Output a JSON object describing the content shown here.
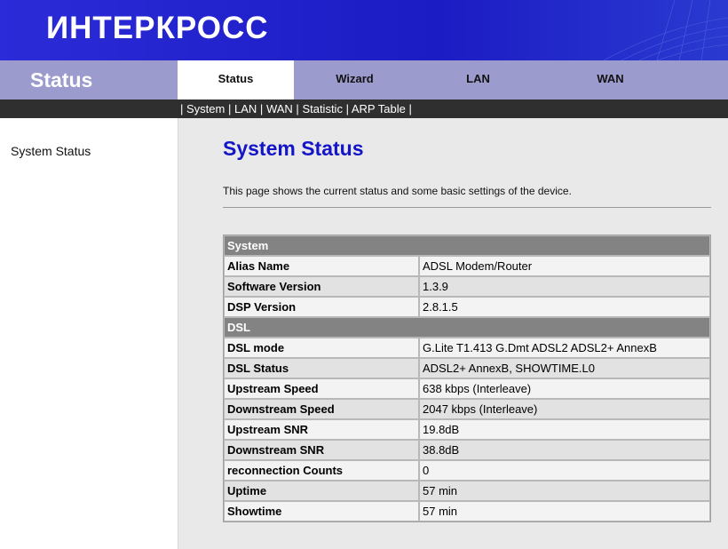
{
  "brand": {
    "logo_text": "ИНТЕРКРОСС"
  },
  "nav": {
    "title": "Status",
    "tabs": [
      {
        "label": "Status",
        "active": true
      },
      {
        "label": "Wizard",
        "active": false
      },
      {
        "label": "LAN",
        "active": false
      },
      {
        "label": "WAN",
        "active": false
      }
    ]
  },
  "subnav": {
    "separator": "|",
    "links": [
      "System",
      "LAN",
      "WAN",
      "Statistic",
      "ARP Table"
    ]
  },
  "sidebar": {
    "items": [
      "System Status"
    ]
  },
  "main": {
    "title": "System Status",
    "description": "This page shows the current status and some basic settings of the device."
  },
  "table": {
    "system_header": "System",
    "system_rows": [
      {
        "label": "Alias Name",
        "value": "ADSL Modem/Router"
      },
      {
        "label": "Software Version",
        "value": "1.3.9"
      },
      {
        "label": "DSP Version",
        "value": "2.8.1.5"
      }
    ],
    "dsl_header": "DSL",
    "dsl_rows": [
      {
        "label": "DSL mode",
        "value": "G.Lite T1.413 G.Dmt ADSL2 ADSL2+ AnnexB"
      },
      {
        "label": "DSL Status",
        "value": "ADSL2+ AnnexB, SHOWTIME.L0"
      },
      {
        "label": "Upstream Speed",
        "value": "638 kbps  (Interleave)"
      },
      {
        "label": "Downstream Speed",
        "value": "2047 kbps  (Interleave)"
      },
      {
        "label": "Upstream SNR",
        "value": "19.8dB"
      },
      {
        "label": "Downstream SNR",
        "value": "38.8dB"
      },
      {
        "label": "reconnection Counts",
        "value": "0"
      },
      {
        "label": "Uptime",
        "value": "57 min"
      },
      {
        "label": "Showtime",
        "value": "57 min"
      }
    ]
  },
  "colors": {
    "banner": "#1c1cc4",
    "navbar": "#9b9bce",
    "subnav": "#2f2f2f",
    "title": "#1414c8",
    "section_header": "#838383"
  }
}
